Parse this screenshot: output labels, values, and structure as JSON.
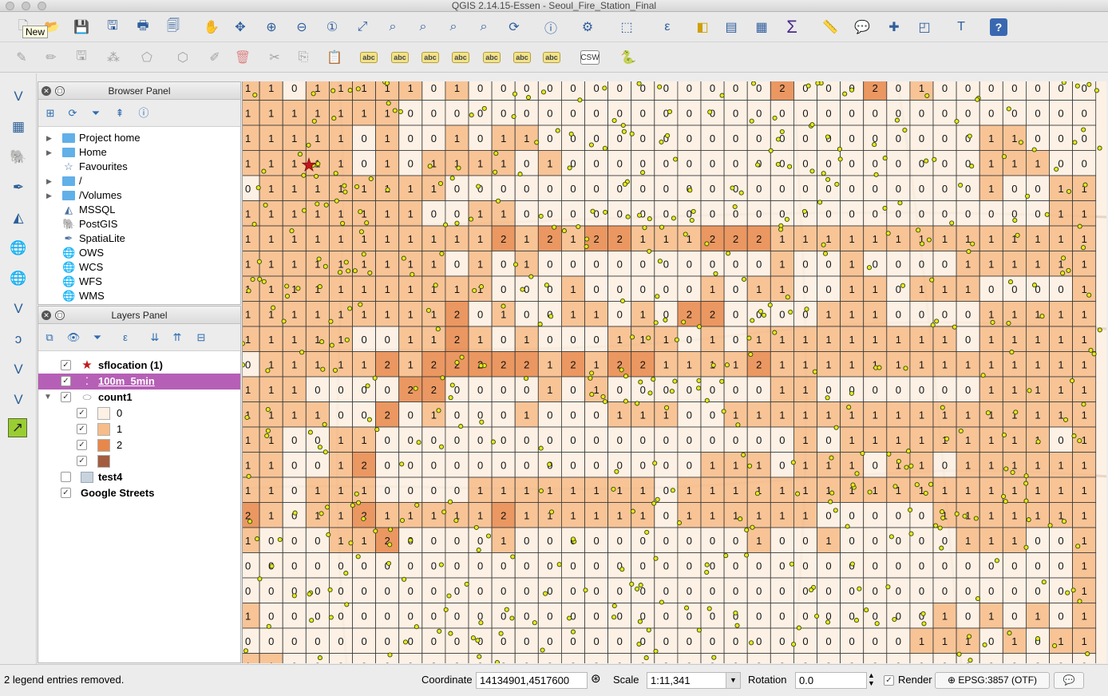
{
  "window": {
    "title": "QGIS 2.14.15-Essen - Seoul_Fire_Station_Final"
  },
  "tooltip": {
    "text": "New"
  },
  "toolbar_row1": [
    "new-project-icon",
    "open-project-icon",
    "save-project-icon",
    "save-as-icon",
    "new-print-composer-icon",
    "composer-manager-icon",
    "pan-icon",
    "pan-to-selection-icon",
    "zoom-in-icon",
    "zoom-out-icon",
    "zoom-native-icon",
    "zoom-full-icon",
    "zoom-to-selection-icon",
    "zoom-to-layer-icon",
    "zoom-last-icon",
    "zoom-next-icon",
    "refresh-icon",
    "identify-icon",
    "action-icon",
    "select-features-icon",
    "select-expression-icon",
    "deselect-icon",
    "attribute-table-icon",
    "field-calculator-icon",
    "statistics-icon",
    "measure-icon",
    "map-tips-icon",
    "new-bookmark-icon",
    "show-bookmarks-icon",
    "text-annotation-icon",
    "help-icon"
  ],
  "toolbar_row2": [
    "current-edits-icon",
    "toggle-editing-icon",
    "save-edits-icon",
    "add-feature-icon",
    "node-tool-icon",
    "move-feature-icon",
    "digitize-icon",
    "delete-selected-icon",
    "cut-features-icon",
    "copy-features-icon",
    "paste-features-icon",
    "label-abc-icon",
    "label-pin-icon",
    "label-highlight-icon",
    "label-show-hide-icon",
    "label-move-icon",
    "label-rotate-icon",
    "label-change-icon",
    "csw-icon",
    "python-icon"
  ],
  "left_toolbar": [
    "add-vector-layer-icon",
    "add-raster-layer-icon",
    "add-postgis-layer-icon",
    "add-spatialite-layer-icon",
    "add-mssql-layer-icon",
    "add-wms-layer-icon",
    "add-wcs-layer-icon",
    "add-wfs-layer-icon",
    "add-delimited-text-icon",
    "add-virtual-layer-icon",
    "new-shapefile-icon",
    "osm-plugin-icon"
  ],
  "browser": {
    "title": "Browser Panel",
    "items": [
      {
        "label": "Project home",
        "icon": "folder",
        "expandable": true
      },
      {
        "label": "Home",
        "icon": "folder",
        "expandable": true
      },
      {
        "label": "Favourites",
        "icon": "star",
        "expandable": false
      },
      {
        "label": "/",
        "icon": "folder",
        "expandable": true
      },
      {
        "label": "/Volumes",
        "icon": "folder",
        "expandable": true
      },
      {
        "label": "MSSQL",
        "icon": "mssql",
        "expandable": false
      },
      {
        "label": "PostGIS",
        "icon": "postgis",
        "expandable": false
      },
      {
        "label": "SpatiaLite",
        "icon": "spatialite",
        "expandable": false
      },
      {
        "label": "OWS",
        "icon": "globe",
        "expandable": false
      },
      {
        "label": "WCS",
        "icon": "globe",
        "expandable": false
      },
      {
        "label": "WFS",
        "icon": "globe",
        "expandable": false
      },
      {
        "label": "WMS",
        "icon": "globe",
        "expandable": false
      }
    ]
  },
  "layers": {
    "title": "Layers Panel",
    "items": [
      {
        "name": "sflocation (1)",
        "checked": true,
        "bold": true,
        "icon": "star"
      },
      {
        "name": "100m_5min",
        "checked": true,
        "bold": true,
        "selected": true,
        "icon": "points"
      },
      {
        "name": "count1",
        "checked": true,
        "bold": true,
        "icon": "polygon"
      },
      {
        "name": "test4",
        "checked": false,
        "bold": true,
        "icon": "raster"
      },
      {
        "name": "Google Streets",
        "checked": true,
        "bold": true,
        "icon": "none"
      }
    ],
    "legend": [
      {
        "label": "0",
        "color": "#fdf1e5"
      },
      {
        "label": "1",
        "color": "#f7bc88"
      },
      {
        "label": "2",
        "color": "#e8874a"
      },
      {
        "label": "",
        "color": "#a35c3e"
      }
    ]
  },
  "map": {
    "grid": [
      "1101111101000000000000020002010000000",
      "1111111000000000000000000000000000000",
      "1111101001011000000000000000000011000",
      "1111101011110100000000000000000011100",
      "0111111110000000000000000000000010011",
      "1111111100110000000000000000000000011",
      "1111111111121212211122211111111111111",
      "1111111110101000000000010010000111111",
      "1111111111100010000010110011011100001",
      "1111111112010011010220000111000011111",
      "1111100112101000111010111111111011111",
      "0111112122222121221111211111111111111",
      "1110000220000101000000011000000011111",
      "1111002010001000111001111111111111111",
      "1100110000000000000000001011111111101",
      "1100120000000000000011101110110111111",
      "1101110000111111110111111111111111111",
      "2101121111121111110111111000001111111",
      "1000112000010000000000100100000111001",
      "0000000000000000000000000000000000001",
      "0000000000000000000000000000000000001",
      "1000000000000000000000000000001010101",
      "0000000000000000000000000000011101011",
      "1100000000000000000000000000000000000"
    ],
    "station_marker": "fire-station-star"
  },
  "status": {
    "message": "2 legend entries removed.",
    "coordinate_label": "Coordinate",
    "coordinate_value": "14134901,4517600",
    "scale_label": "Scale",
    "scale_value": "1:11,341",
    "rotation_label": "Rotation",
    "rotation_value": "0.0",
    "render_label": "Render",
    "crs_label": "EPSG:3857 (OTF)"
  }
}
